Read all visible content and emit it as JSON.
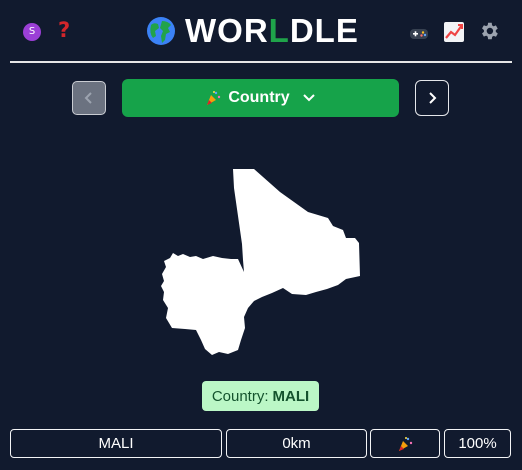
{
  "header": {
    "badge_letter": "S",
    "help_icon": "question-mark-icon",
    "logo_prefix": "WOR",
    "logo_accent": "L",
    "logo_suffix": "DLE",
    "accent_color": "#1fa34a",
    "icons": [
      "globe-icon",
      "gamepad-icon",
      "chart-icon",
      "gear-icon"
    ]
  },
  "mode_selector": {
    "label": "Country",
    "icon": "party-popper-icon",
    "color": "#16a34a"
  },
  "answer": {
    "prefix": "Country:",
    "value": "MALI"
  },
  "guess_row": {
    "country": "MALI",
    "distance": "0km",
    "direction_icon": "party-popper-icon",
    "proximity": "100%"
  },
  "colors": {
    "background": "#111a2e",
    "answer_bg": "#bbf7c6"
  }
}
